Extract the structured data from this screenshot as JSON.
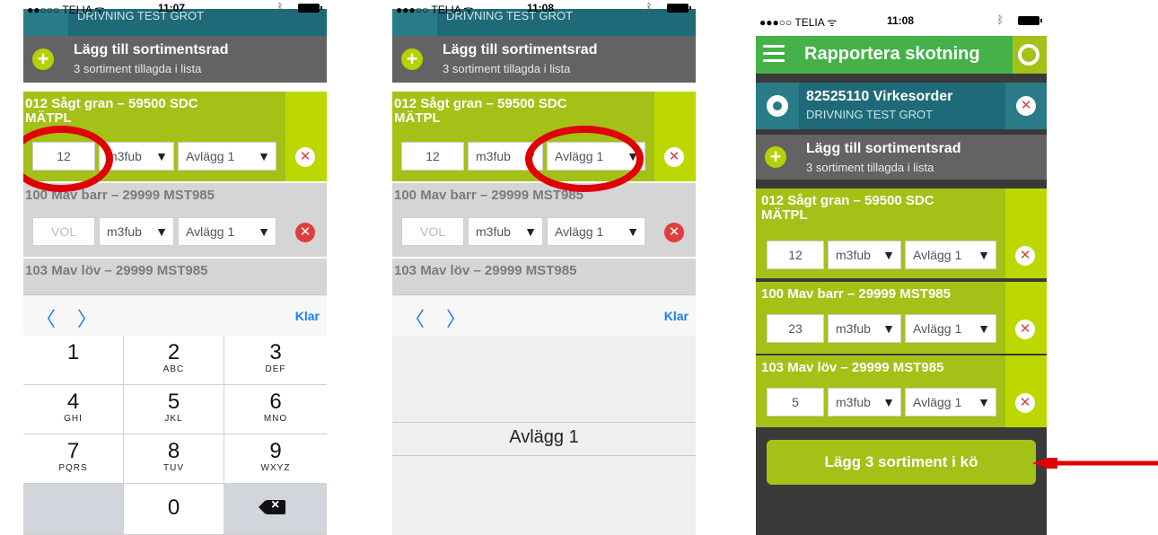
{
  "status": {
    "carrier": "●●○○○ TELIA ᯤ",
    "carrier3": "●●●○○ TELIA ᯤ",
    "time1": "11:07",
    "time2": "11:08",
    "time3": "11:08"
  },
  "header": {
    "title": "Rapportera skotning",
    "order_title": "82525110 Virkesorder",
    "order_sub": "DRIVNING TEST GROT"
  },
  "add_row": {
    "title": "Lägg till sortimentsrad",
    "sub": "3 sortiment tillagda i lista"
  },
  "items": [
    {
      "name": "012 Sågt gran – 59500 SDC\nMÄTPL",
      "volume": "12",
      "unit": "m3fub",
      "dest": "Avlägg 1"
    },
    {
      "name": "100 Mav barr – 29999 MST985",
      "volume": "23",
      "placeholder": "VOL",
      "unit": "m3fub",
      "dest": "Avlägg 1"
    },
    {
      "name": "103 Mav löv – 29999 MST985",
      "volume": "5",
      "unit": "m3fub",
      "dest": "Avlägg 1"
    }
  ],
  "arrow_glyph": "▼",
  "delete_glyph": "✕",
  "accessory": {
    "prev": "〈",
    "next": "〉",
    "done": "Klar"
  },
  "keypad": [
    {
      "num": "1",
      "letters": ""
    },
    {
      "num": "2",
      "letters": "ABC"
    },
    {
      "num": "3",
      "letters": "DEF"
    },
    {
      "num": "4",
      "letters": "GHI"
    },
    {
      "num": "5",
      "letters": "JKL"
    },
    {
      "num": "6",
      "letters": "MNO"
    },
    {
      "num": "7",
      "letters": "PQRS"
    },
    {
      "num": "8",
      "letters": "TUV"
    },
    {
      "num": "9",
      "letters": "WXYZ"
    },
    {
      "num": "0",
      "letters": ""
    }
  ],
  "picker": {
    "option": "Avlägg 1"
  },
  "submit": {
    "label": "Lägg 3 sortiment i kö"
  },
  "colors": {
    "green": "#a3c117",
    "title_green": "#45b149",
    "teal": "#1f6a78",
    "red": "#e00000"
  },
  "icons": [
    "plus-icon",
    "delete-icon",
    "gear-icon",
    "menu-icon",
    "status-ring-icon",
    "backspace-icon"
  ]
}
